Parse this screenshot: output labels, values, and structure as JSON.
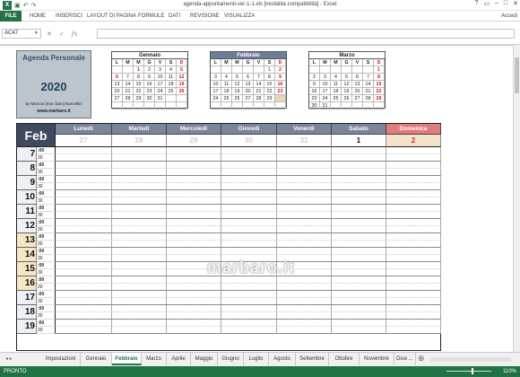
{
  "titlebar": {
    "app_icon": "X",
    "title": "agenda-appuntamenti-ver-1-1.xls [modalità compatibilità] - Excel",
    "qat": [
      "save-icon",
      "undo-icon",
      "redo-icon"
    ],
    "controls": [
      "?",
      "▭",
      "–",
      "□",
      "✕"
    ]
  },
  "ribbon": {
    "tabs": [
      "FILE",
      "HOME",
      "INSERISCI",
      "LAYOUT DI PAGINA",
      "FORMULE",
      "DATI",
      "REVISIONE",
      "VISUALIZZA"
    ],
    "user": "Accedi"
  },
  "formula_bar": {
    "name_box": "AC47",
    "fx": "fx",
    "cancel": "✕",
    "enter": "✓",
    "value": ""
  },
  "agenda": {
    "title": "Agenda Personale",
    "year": "2020",
    "author": "by Marcos [mar::barc] Barcellini",
    "website": "www.marbaro.it"
  },
  "mini_calendars": [
    {
      "name": "Gennaio",
      "weekdays": [
        "L",
        "M",
        "M",
        "G",
        "V",
        "S",
        "D"
      ],
      "weeks": [
        [
          "",
          "",
          "1",
          "2",
          "3",
          "4",
          "5"
        ],
        [
          "6",
          "7",
          "8",
          "9",
          "10",
          "11",
          "12"
        ],
        [
          "13",
          "14",
          "15",
          "16",
          "17",
          "18",
          "19"
        ],
        [
          "20",
          "21",
          "22",
          "23",
          "24",
          "25",
          "26"
        ],
        [
          "27",
          "28",
          "29",
          "30",
          "31",
          "",
          ""
        ],
        [
          "",
          "",
          "",
          "",
          "",
          "",
          ""
        ]
      ],
      "red_days": [
        "1",
        "5",
        "6",
        "12",
        "19",
        "26"
      ]
    },
    {
      "name": "Febbraio",
      "weekdays": [
        "L",
        "M",
        "M",
        "G",
        "V",
        "S",
        "D"
      ],
      "weeks": [
        [
          "",
          "",
          "",
          "",
          "",
          "1",
          "2"
        ],
        [
          "3",
          "4",
          "5",
          "6",
          "7",
          "8",
          "9"
        ],
        [
          "10",
          "11",
          "12",
          "13",
          "14",
          "15",
          "16"
        ],
        [
          "17",
          "18",
          "19",
          "20",
          "21",
          "22",
          "23"
        ],
        [
          "24",
          "25",
          "26",
          "27",
          "28",
          "29",
          ""
        ],
        [
          "",
          "",
          "",
          "",
          "",
          "",
          ""
        ]
      ],
      "red_days": [
        "2",
        "9",
        "16",
        "23"
      ]
    },
    {
      "name": "Marzo",
      "weekdays": [
        "L",
        "M",
        "M",
        "G",
        "V",
        "S",
        "D"
      ],
      "weeks": [
        [
          "",
          "",
          "",
          "",
          "",
          "",
          "1"
        ],
        [
          "2",
          "3",
          "4",
          "5",
          "6",
          "7",
          "8"
        ],
        [
          "9",
          "10",
          "11",
          "12",
          "13",
          "14",
          "15"
        ],
        [
          "16",
          "17",
          "18",
          "19",
          "20",
          "21",
          "22"
        ],
        [
          "23",
          "24",
          "25",
          "26",
          "27",
          "28",
          "29"
        ],
        [
          "30",
          "31",
          "",
          "",
          "",
          "",
          ""
        ]
      ],
      "red_days": [
        "1",
        "8",
        "15",
        "22",
        "29"
      ]
    }
  ],
  "week_view": {
    "month": "Feb",
    "days": [
      {
        "name": "Lunedì",
        "date": "27"
      },
      {
        "name": "Martedì",
        "date": "28"
      },
      {
        "name": "Mercoledì",
        "date": "29"
      },
      {
        "name": "Giovedì",
        "date": "30"
      },
      {
        "name": "Venerdì",
        "date": "31"
      },
      {
        "name": "Sabato",
        "date": "1"
      },
      {
        "name": "Domenica",
        "date": "2"
      }
    ],
    "hours": [
      {
        "h": "7",
        "weekend": false
      },
      {
        "h": "8",
        "weekend": false
      },
      {
        "h": "9",
        "weekend": false
      },
      {
        "h": "10",
        "weekend": false
      },
      {
        "h": "11",
        "weekend": false
      },
      {
        "h": "12",
        "weekend": false
      },
      {
        "h": "13",
        "weekend": true
      },
      {
        "h": "14",
        "weekend": true
      },
      {
        "h": "15",
        "weekend": true
      },
      {
        "h": "16",
        "weekend": true
      },
      {
        "h": "17",
        "weekend": false
      },
      {
        "h": "18",
        "weekend": false
      },
      {
        "h": "19",
        "weekend": false
      }
    ],
    "minutes": [
      ":00",
      "30"
    ],
    "watermark": "marbaro.it"
  },
  "sheet_tabs": {
    "tabs": [
      "Impostazioni",
      "Gennaio",
      "Febbraio",
      "Marzo",
      "Aprile",
      "Maggio",
      "Giugno",
      "Luglio",
      "Agosto",
      "Settembre",
      "Ottobre",
      "Novembre",
      "Dice ..."
    ],
    "active": "Febbraio",
    "nav": "◂  ▸"
  },
  "status": {
    "left": "PRONTO",
    "zoom": "110%"
  }
}
